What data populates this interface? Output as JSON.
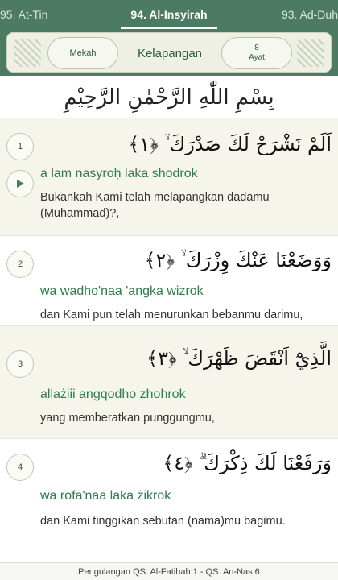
{
  "tabs": {
    "prev": "95. At-Tin",
    "current": "94. Al-Insyirah",
    "next": "93. Ad-Duh"
  },
  "header": {
    "place": "Mekah",
    "meaning": "Kelapangan",
    "ayat_count": "8",
    "ayat_label": "Ayat"
  },
  "bismillah": "بِسْمِ اللّٰهِ الرَّحْمٰنِ الرَّحِيْمِ",
  "verses": [
    {
      "number": "1",
      "arabic": "اَلَمْ نَشْرَحْ لَكَ صَدْرَكَ ۙ ﴿١﴾",
      "latin": "a lam nasyroḥ laka shodrok",
      "translation": "Bukankah Kami telah melapangkan dadamu (Muhammad)?,"
    },
    {
      "number": "2",
      "arabic": "وَوَضَعْنَا عَنْكَ وِزْرَكَ ۙ ﴿٢﴾",
      "latin": "wa wadho'naa 'angka wizrok",
      "translation": "dan Kami pun telah menurunkan bebanmu darimu,"
    },
    {
      "number": "3",
      "arabic": "الَّذِيْٓ اَنْقَضَ ظَهْرَكَ ۙ ﴿٣﴾",
      "latin": "allażiii angqodho zhohrok",
      "translation": "yang memberatkan punggungmu,"
    },
    {
      "number": "4",
      "arabic": "وَرَفَعْنَا لَكَ ذِكْرَكَ ۗ ﴿٤﴾",
      "latin": "wa rofa'naa laka żikrok",
      "translation": "dan Kami tinggikan sebutan (nama)mu bagimu."
    }
  ],
  "footer": "Pengulangan QS. Al-Fatihah:1 - QS. An-Nas:6",
  "colors": {
    "header_green": "#4d7a62",
    "latin_green": "#2e7d4c",
    "alt_row": "#f5f5ec"
  }
}
